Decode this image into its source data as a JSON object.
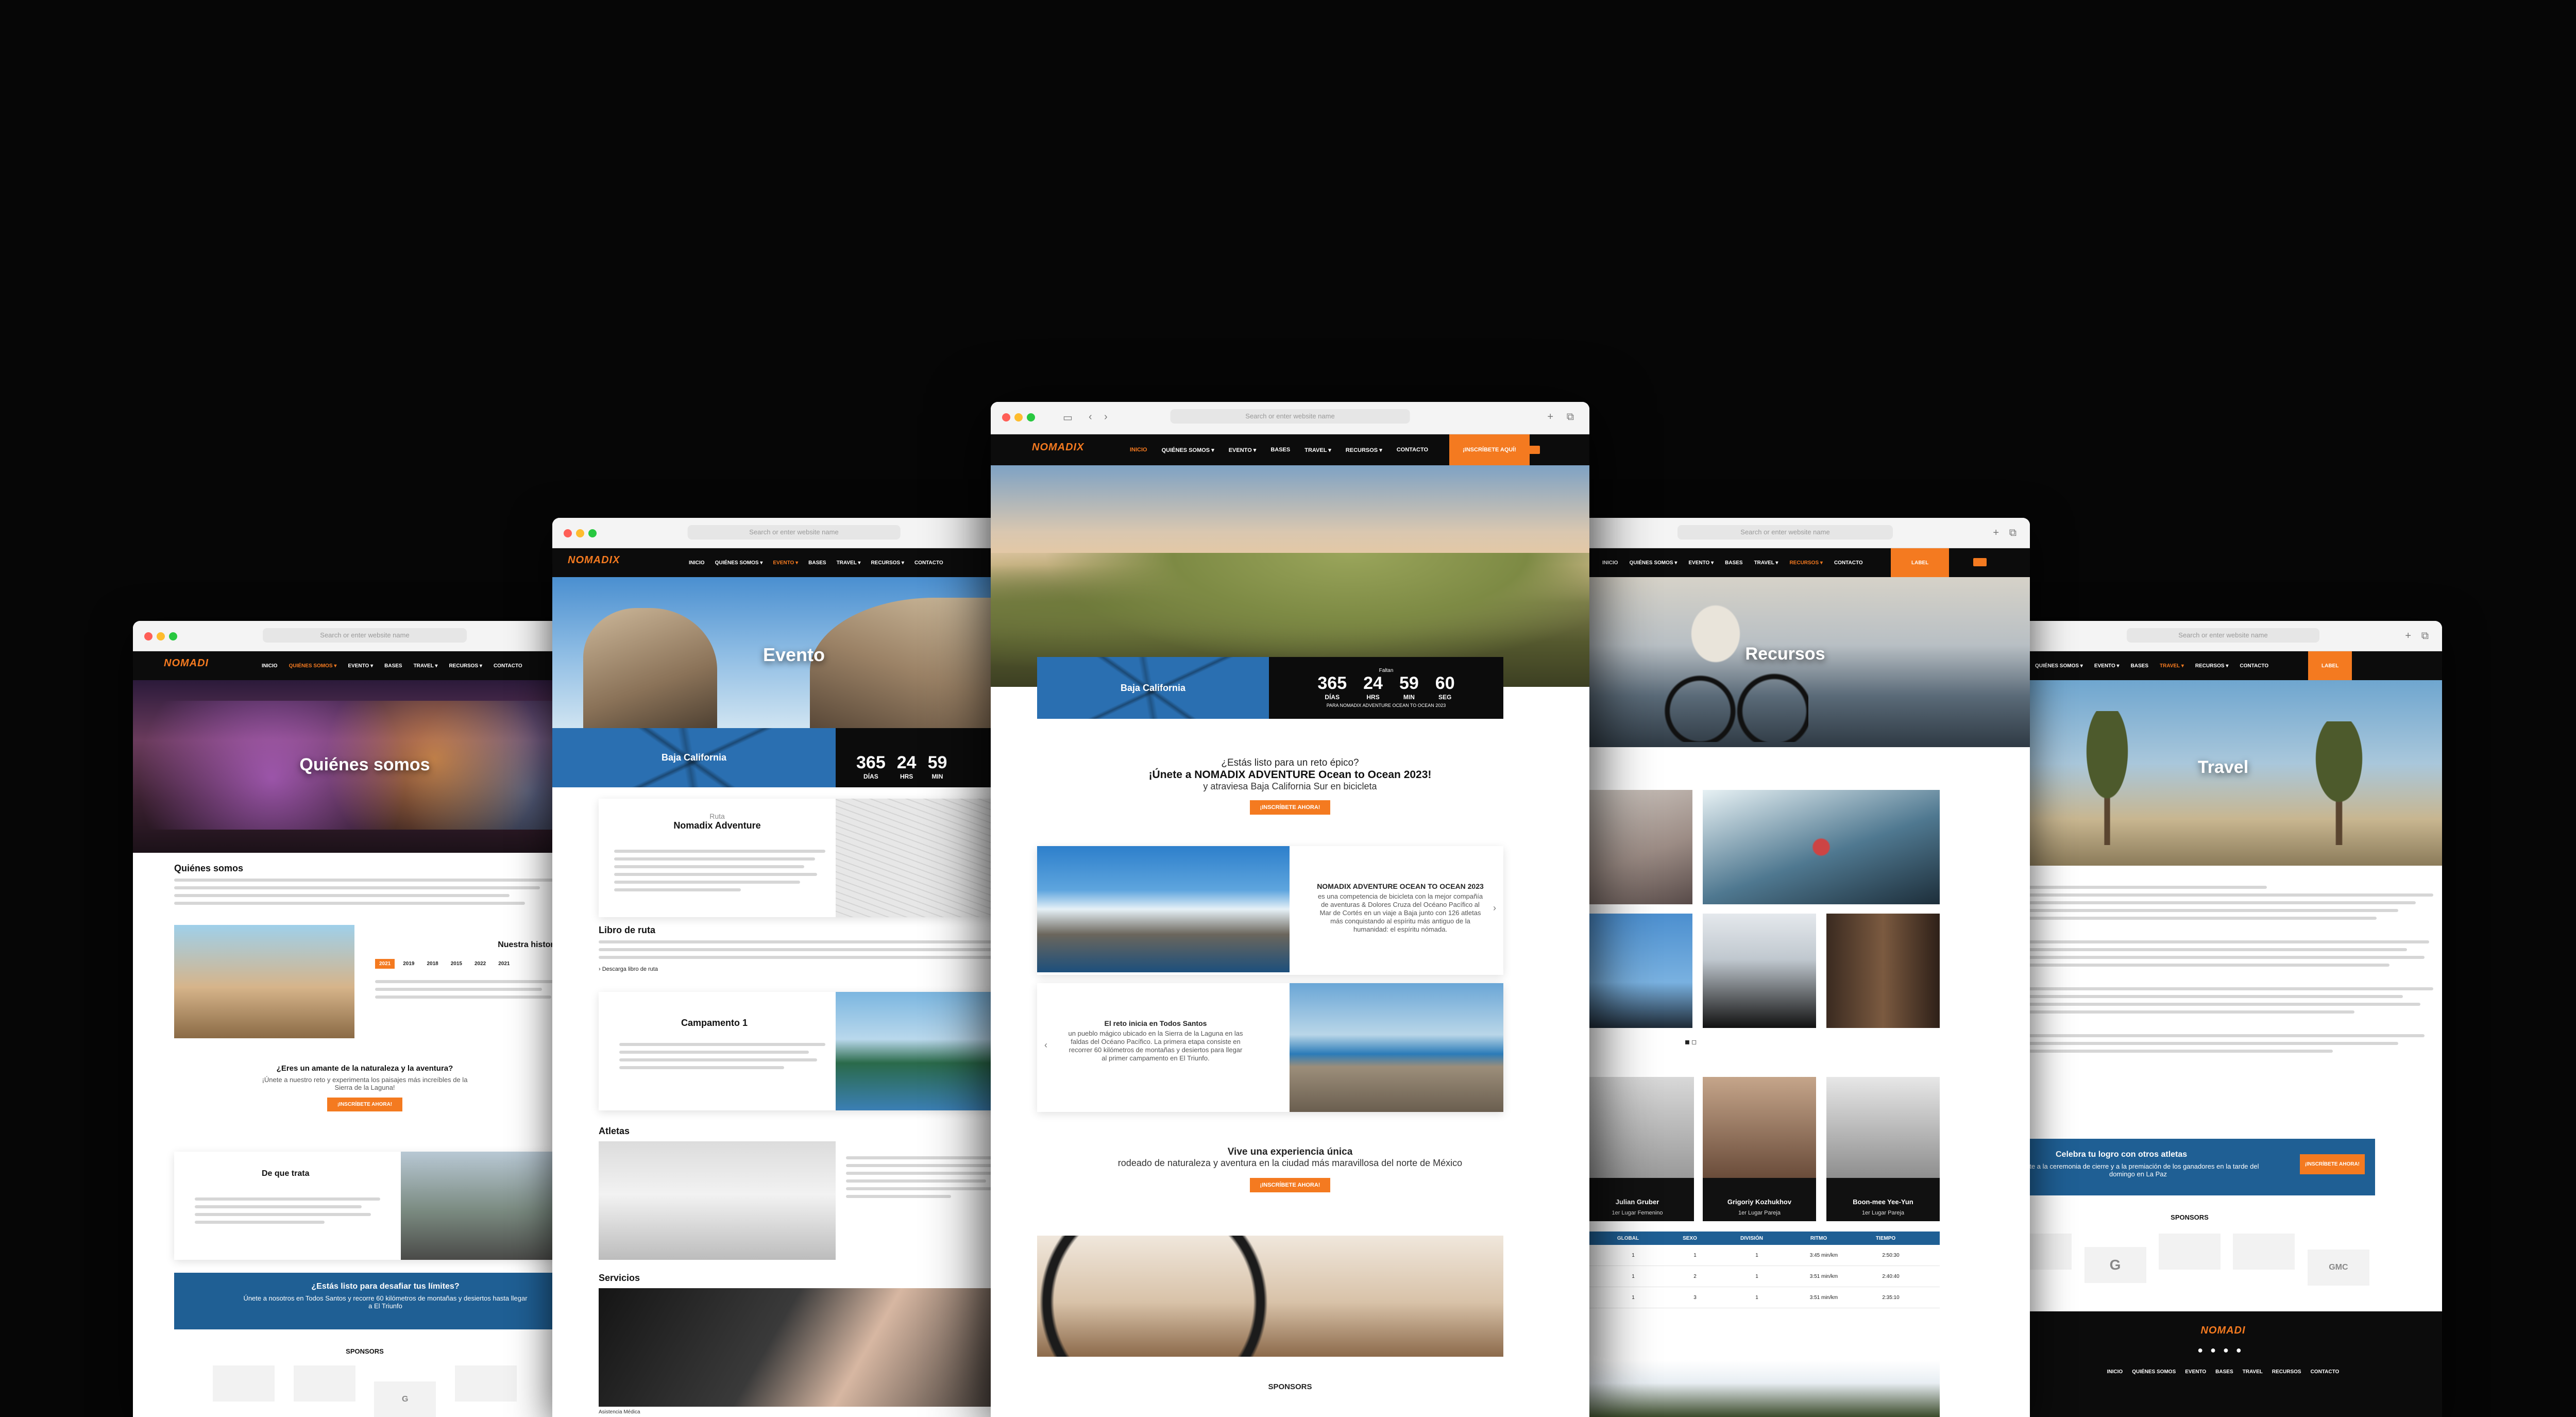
{
  "browser": {
    "url_placeholder": "Search or enter website name"
  },
  "brand": {
    "logo_main": "NOMADI",
    "logo_accent": "X",
    "accent": "#f47a20",
    "dark": "#0c0c0c"
  },
  "nav": {
    "items": [
      "INICIO",
      "QUIÉNES SOMOS ▾",
      "EVENTO ▾",
      "BASES",
      "TRAVEL ▾",
      "RECURSOS ▾",
      "CONTACTO"
    ],
    "cta": "¡INSCRÍBETE AQUÍ!",
    "cta_short": "LABEL"
  },
  "countdown": {
    "label": "Faltan",
    "days": "365",
    "days_label": "DÍAS",
    "hours": "24",
    "hours_label": "HRS",
    "min": "59",
    "min_label": "MIN",
    "sec": "60",
    "sec_label": "SEG",
    "caption": "PARA NOMADIX ADVENTURE OCEAN TO OCEAN 2023",
    "map_label": "Baja California"
  },
  "center": {
    "intro_q": "¿Estás listo para un reto épico?",
    "intro_h": "¡Únete a NOMADIX ADVENTURE Ocean to Ocean 2023!",
    "intro_s": "y atraviesa Baja California Sur en bicicleta",
    "btn": "¡INSCRÍBETE AHORA!",
    "card1_title": "NOMADIX ADVENTURE OCEAN TO OCEAN 2023",
    "card1_text": "es una competencia de bicicleta con la mejor compañía de aventuras & Dolores Cruza del Océano Pacífico al Mar de Cortés en un viaje a Baja junto con 126 atletas más conquistando al espíritu más antiguo de la humanidad: el espíritu nómada.",
    "card2_title": "El reto inicia en Todos Santos",
    "card2_text": "un pueblo mágico ubicado en la Sierra de la Laguna en las faldas del Océano Pacífico. La primera etapa consiste en recorrer 60 kilómetros de montañas y desiertos para llegar al primer campamento en El Triunfo.",
    "vive_h": "Vive una experiencia única",
    "vive_s": "rodeado de naturaleza y aventura en la ciudad más maravillosa del norte de México",
    "sponsors": "SPONSORS"
  },
  "evento": {
    "hero": "Evento",
    "ruta_small": "Ruta",
    "ruta_title": "Nomadix Adventure",
    "libro": "Libro de ruta",
    "download": "Descarga libro de ruta",
    "camp": "Campamento 1",
    "atletas": "Atletas",
    "servicios": "Servicios",
    "asistencia": "Asistencia Médica"
  },
  "quienes": {
    "hero": "Quiénes somos",
    "section": "Quiénes somos",
    "historia": "Nuestra historia",
    "years": [
      "2021",
      "2019",
      "2018",
      "2015",
      "2022",
      "2021"
    ],
    "amante_h": "¿Eres un amante de la naturaleza y la aventura?",
    "amante_s": "¡Únete a nuestro reto y experimenta los paisajes más increíbles de la Sierra de la Laguna!",
    "btn": "¡INSCRÍBETE AHORA!",
    "detrata": "De que trata",
    "banner_h": "¿Estás listo para desafiar tus límites?",
    "banner_s": "Únete a nosotros en Todos Santos y recorre 60 kilómetros de montañas y desiertos hasta llegar a El Triunfo",
    "sponsors": "SPONSORS"
  },
  "recursos": {
    "hero": "Recursos",
    "athletes": [
      {
        "name": "Julian Gruber",
        "place": "1er Lugar Femenino"
      },
      {
        "name": "Grigoriy Kozhukhov",
        "place": "1er Lugar Pareja"
      },
      {
        "name": "Boon-mee Yee-Yun",
        "place": "1er Lugar Pareja"
      }
    ],
    "table_headers": [
      "GLOBAL",
      "SEXO",
      "DIVISIÓN",
      "RITMO",
      "TIEMPO"
    ],
    "table_rows": [
      [
        "1",
        "1",
        "1",
        "3:45 min/km",
        "2:50:30"
      ],
      [
        "1",
        "2",
        "1",
        "3:51 min/km",
        "2:40:40"
      ],
      [
        "1",
        "3",
        "1",
        "3:51 min/km",
        "2:35:10"
      ]
    ]
  },
  "travel": {
    "hero": "Travel",
    "banner_h": "Celebra tu logro con otros atletas",
    "banner_s": "Únete a la ceremonia de cierre y a la premiación de los ganadores en la tarde del domingo en La Paz",
    "btn": "¡INSCRÍBETE AHORA!",
    "sponsors": "SPONSORS",
    "sponsor_names": [
      "G",
      "GMC"
    ],
    "footer_nav": [
      "INICIO",
      "QUIÉNES SOMOS",
      "EVENTO",
      "BASES",
      "TRAVEL",
      "RECURSOS",
      "CONTACTO"
    ]
  }
}
